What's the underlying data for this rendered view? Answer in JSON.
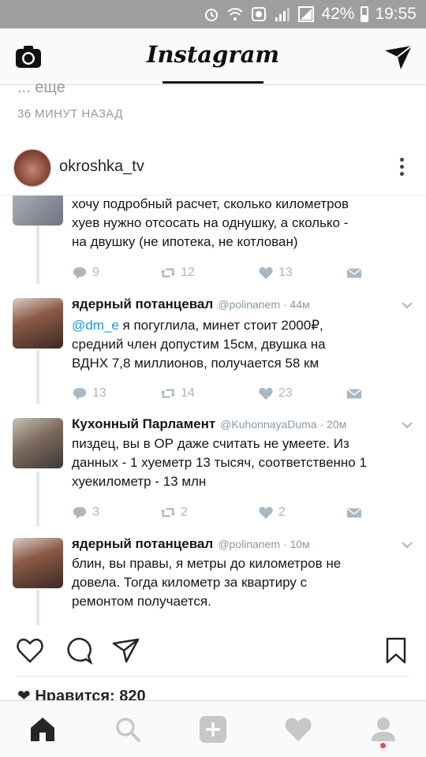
{
  "status_bar": {
    "battery": "42%",
    "time": "19:55"
  },
  "header": {
    "logo": "Instagram"
  },
  "previous_post": {
    "more": "... еще",
    "time_ago": "36 МИНУТ НАЗАД"
  },
  "post": {
    "username": "okroshka_tv",
    "likes": "Нравится: 820"
  },
  "tweets": [
    {
      "text": "хочу подробный расчет, сколько километров\nхуев нужно отсосать на однушку, а сколько -\nна двушку (не ипотека, не котлован)",
      "replies": "9",
      "retweets": "12",
      "likes": "13"
    },
    {
      "name": "ядерный потанцевал",
      "handle": "@polinanem · 44м",
      "mention": "@dm_e",
      "text": " я погуглила, минет стоит 2000₽,\nсредний член допустим 15см, двушка на\nВДНХ 7,8 миллионов, получается 58 км",
      "replies": "13",
      "retweets": "14",
      "likes": "23"
    },
    {
      "name": "Кухонный Парламент",
      "handle": "@KuhonnayaDuma · 20м",
      "text": "пиздец, вы в ОР даже считать не умеете. Из\nданных - 1 хуеметр 13 тысяч, соответственно 1\nхуекилометр - 13 млн",
      "replies": "3",
      "retweets": "2",
      "likes": "2"
    },
    {
      "name": "ядерный потанцевал",
      "handle": "@polinanem · 10м",
      "text": "блин, вы правы, я метры до километров не\nдовела. Тогда километр за квартиру с\nремонтом получается."
    }
  ],
  "colors": {
    "status_bar": "#9e9e9e",
    "twitter_grey": "#aab8c2",
    "mention": "#1b95e0",
    "notification": "#ed4956"
  },
  "icons": [
    "camera-icon",
    "direct-send-icon",
    "heart-icon",
    "comment-icon",
    "share-icon",
    "bookmark-icon",
    "home-icon",
    "search-icon",
    "add-icon",
    "activity-icon",
    "profile-icon"
  ]
}
